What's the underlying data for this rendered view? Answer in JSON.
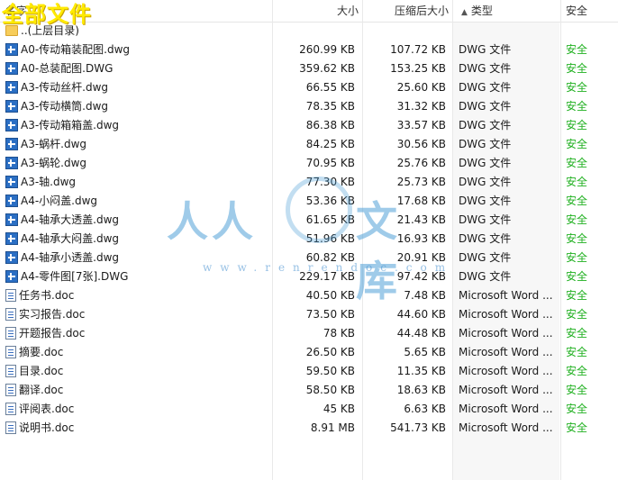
{
  "banner": "全部文件",
  "columns": {
    "name": "名字",
    "size": "大小",
    "compressed": "压缩后大小",
    "type": "类型",
    "safety": "安全"
  },
  "sort": {
    "column": "type",
    "indicator": "up-arrow-icon"
  },
  "parent_dir": "..(上层目录)",
  "files": [
    {
      "name": "A0-传动箱装配图.dwg",
      "size": "260.99 KB",
      "compressed": "107.72 KB",
      "type": "DWG 文件",
      "safety": "安全",
      "icon": "dwg-file-icon"
    },
    {
      "name": "A0-总装配图.DWG",
      "size": "359.62 KB",
      "compressed": "153.25 KB",
      "type": "DWG 文件",
      "safety": "安全",
      "icon": "dwg-file-icon"
    },
    {
      "name": "A3-传动丝杆.dwg",
      "size": "66.55 KB",
      "compressed": "25.60 KB",
      "type": "DWG 文件",
      "safety": "安全",
      "icon": "dwg-file-icon"
    },
    {
      "name": "A3-传动横筒.dwg",
      "size": "78.35 KB",
      "compressed": "31.32 KB",
      "type": "DWG 文件",
      "safety": "安全",
      "icon": "dwg-file-icon"
    },
    {
      "name": "A3-传动箱箱盖.dwg",
      "size": "86.38 KB",
      "compressed": "33.57 KB",
      "type": "DWG 文件",
      "safety": "安全",
      "icon": "dwg-file-icon"
    },
    {
      "name": "A3-蜗杆.dwg",
      "size": "84.25 KB",
      "compressed": "30.56 KB",
      "type": "DWG 文件",
      "safety": "安全",
      "icon": "dwg-file-icon"
    },
    {
      "name": "A3-蜗轮.dwg",
      "size": "70.95 KB",
      "compressed": "25.76 KB",
      "type": "DWG 文件",
      "safety": "安全",
      "icon": "dwg-file-icon"
    },
    {
      "name": "A3-轴.dwg",
      "size": "77.30 KB",
      "compressed": "25.73 KB",
      "type": "DWG 文件",
      "safety": "安全",
      "icon": "dwg-file-icon"
    },
    {
      "name": "A4-小闷盖.dwg",
      "size": "53.36 KB",
      "compressed": "17.68 KB",
      "type": "DWG 文件",
      "safety": "安全",
      "icon": "dwg-file-icon"
    },
    {
      "name": "A4-轴承大透盖.dwg",
      "size": "61.65 KB",
      "compressed": "21.43 KB",
      "type": "DWG 文件",
      "safety": "安全",
      "icon": "dwg-file-icon"
    },
    {
      "name": "A4-轴承大闷盖.dwg",
      "size": "51.96 KB",
      "compressed": "16.93 KB",
      "type": "DWG 文件",
      "safety": "安全",
      "icon": "dwg-file-icon"
    },
    {
      "name": "A4-轴承小透盖.dwg",
      "size": "60.82 KB",
      "compressed": "20.91 KB",
      "type": "DWG 文件",
      "safety": "安全",
      "icon": "dwg-file-icon"
    },
    {
      "name": "A4-零件图[7张].DWG",
      "size": "229.17 KB",
      "compressed": "97.42 KB",
      "type": "DWG 文件",
      "safety": "安全",
      "icon": "dwg-file-icon"
    },
    {
      "name": "任务书.doc",
      "size": "40.50 KB",
      "compressed": "7.48 KB",
      "type": "Microsoft Word ...",
      "safety": "安全",
      "icon": "word-doc-icon"
    },
    {
      "name": "实习报告.doc",
      "size": "73.50 KB",
      "compressed": "44.60 KB",
      "type": "Microsoft Word ...",
      "safety": "安全",
      "icon": "word-doc-icon"
    },
    {
      "name": "开题报告.doc",
      "size": "78 KB",
      "compressed": "44.48 KB",
      "type": "Microsoft Word ...",
      "safety": "安全",
      "icon": "word-doc-icon"
    },
    {
      "name": "摘要.doc",
      "size": "26.50 KB",
      "compressed": "5.65 KB",
      "type": "Microsoft Word ...",
      "safety": "安全",
      "icon": "word-doc-icon"
    },
    {
      "name": "目录.doc",
      "size": "59.50 KB",
      "compressed": "11.35 KB",
      "type": "Microsoft Word ...",
      "safety": "安全",
      "icon": "word-doc-icon"
    },
    {
      "name": "翻译.doc",
      "size": "58.50 KB",
      "compressed": "18.63 KB",
      "type": "Microsoft Word ...",
      "safety": "安全",
      "icon": "word-doc-icon"
    },
    {
      "name": "评阅表.doc",
      "size": "45 KB",
      "compressed": "6.63 KB",
      "type": "Microsoft Word ...",
      "safety": "安全",
      "icon": "word-doc-icon"
    },
    {
      "name": "说明书.doc",
      "size": "8.91 MB",
      "compressed": "541.73 KB",
      "type": "Microsoft Word ...",
      "safety": "安全",
      "icon": "word-doc-icon"
    }
  ],
  "watermark": {
    "text_left": "人人",
    "text_right": "文库",
    "url": "www.renrendoc.com"
  },
  "colors": {
    "safe": "#20b020",
    "banner": "#ffea00",
    "dwg_icon": "#2b6fc4",
    "folder": "#f7cd5a"
  }
}
